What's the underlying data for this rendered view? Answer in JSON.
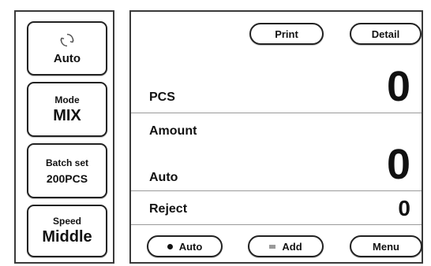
{
  "sidebar": {
    "auto": {
      "label": "Auto"
    },
    "mode": {
      "caption": "Mode",
      "value": "MIX"
    },
    "batch": {
      "caption": "Batch set",
      "value": "200PCS"
    },
    "speed": {
      "caption": "Speed",
      "value": "Middle"
    }
  },
  "top_buttons": {
    "print": "Print",
    "detail": "Detail"
  },
  "display": {
    "pcs_label": "PCS",
    "pcs_value": "0",
    "amount_label": "Amount",
    "auto_label": "Auto",
    "amount_value": "0",
    "reject_label": "Reject",
    "reject_value": "0"
  },
  "bottom_buttons": {
    "auto": "Auto",
    "add": "Add",
    "menu": "Menu"
  },
  "icons": {
    "auto": "sync-icon",
    "auto_mode": "dot-icon",
    "add": "square-icon"
  }
}
